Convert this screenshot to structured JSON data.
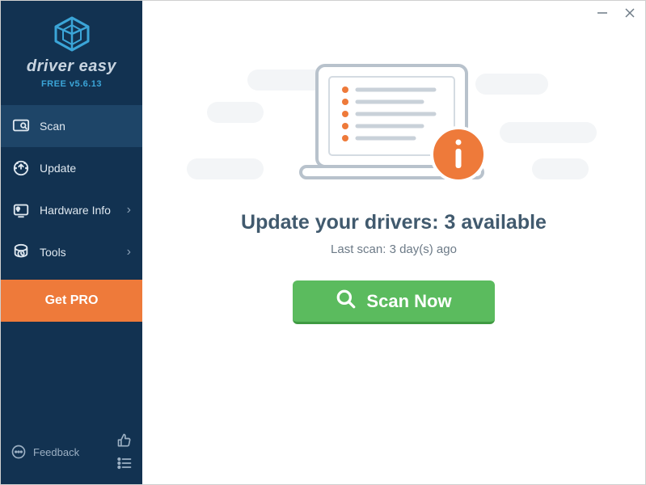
{
  "app": {
    "name": "driver easy",
    "version_label": "FREE v5.6.13"
  },
  "sidebar": {
    "items": [
      {
        "label": "Scan",
        "icon": "scan"
      },
      {
        "label": "Update",
        "icon": "update"
      },
      {
        "label": "Hardware Info",
        "icon": "hardware"
      },
      {
        "label": "Tools",
        "icon": "tools"
      }
    ],
    "pro_label": "Get PRO",
    "feedback_label": "Feedback"
  },
  "main": {
    "headline": "Update your drivers: 3 available",
    "subline": "Last scan: 3 day(s) ago",
    "scan_button": "Scan Now"
  },
  "colors": {
    "sidebar_bg": "#123251",
    "accent_orange": "#ee7a3a",
    "accent_green": "#5bbb5e",
    "info_orange": "#ee7a3a"
  }
}
